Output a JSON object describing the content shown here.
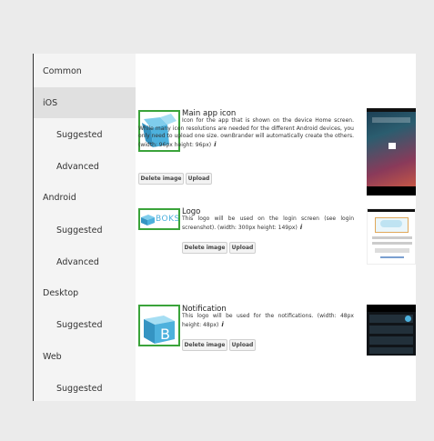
{
  "sidebar": {
    "items": [
      {
        "label": "Common"
      },
      {
        "label": "iOS"
      },
      {
        "label": "Suggested"
      },
      {
        "label": "Advanced"
      },
      {
        "label": "Android"
      },
      {
        "label": "Suggested"
      },
      {
        "label": "Advanced"
      },
      {
        "label": "Desktop"
      },
      {
        "label": "Suggested"
      },
      {
        "label": "Web"
      },
      {
        "label": "Suggested"
      }
    ]
  },
  "sections": [
    {
      "title": "Main app icon",
      "description": "Icon for the app that is shown on the device Home screen. While many icon resolutions are needed for the different Android devices, you only need to upload one size. ownBrander will automatically create the others. (width: 96px height: 96px)",
      "info_icon": "i",
      "delete_label": "Delete image",
      "upload_label": "Upload"
    },
    {
      "title": "Logo",
      "description": "This logo will be used on the login screen (see login screenshot). (width: 300px height: 149px)",
      "info_icon": "i",
      "delete_label": "Delete image",
      "upload_label": "Upload",
      "logo_text": "BOKS"
    },
    {
      "title": "Notification",
      "description": "This logo will be used for the notifications. (width: 48px height: 48px)",
      "info_icon": "i",
      "delete_label": "Delete image",
      "upload_label": "Upload"
    }
  ],
  "colors": {
    "thumb_border": "#3aa33a",
    "box_blue": "#4db1dd"
  }
}
